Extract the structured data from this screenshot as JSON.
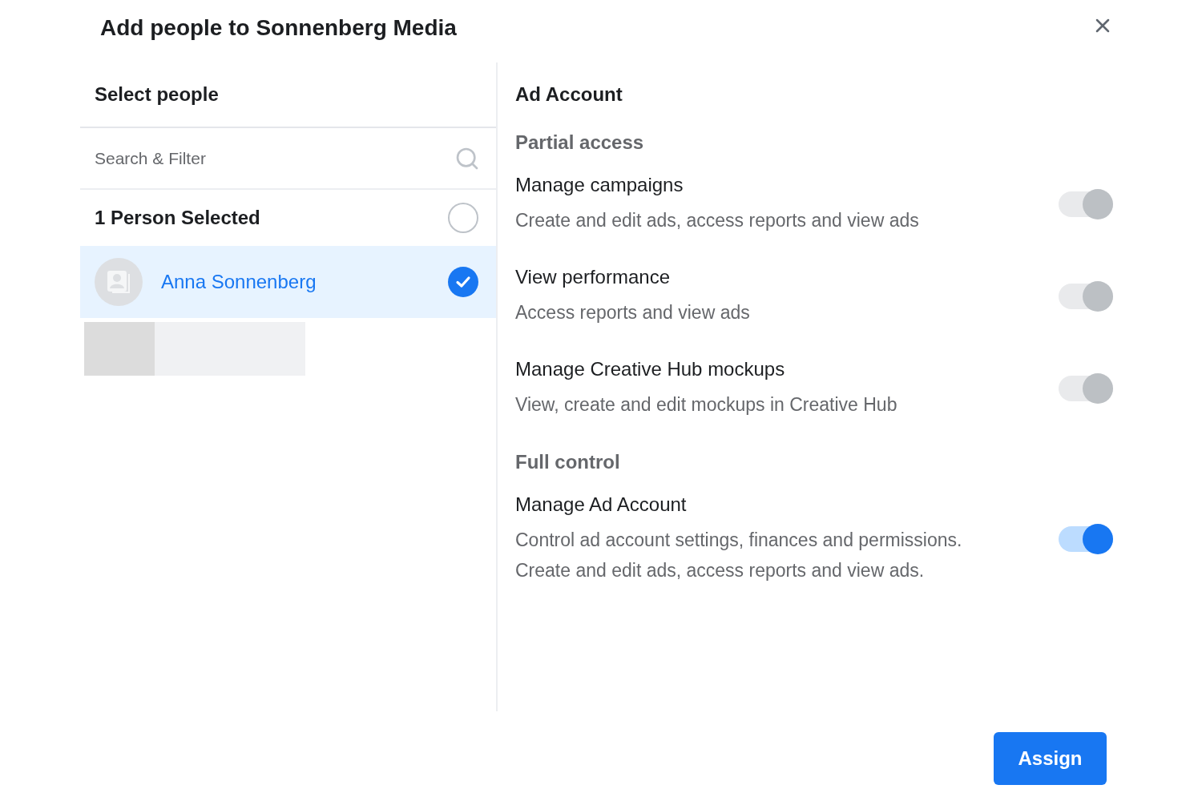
{
  "dialog": {
    "title": "Add people to Sonnenberg Media"
  },
  "people_panel": {
    "heading": "Select people",
    "search": {
      "placeholder": "Search & Filter"
    },
    "summary": {
      "label": "1 Person Selected",
      "checked": false
    },
    "people": [
      {
        "name": "Anna Sonnenberg",
        "selected": true
      }
    ]
  },
  "permissions_panel": {
    "heading": "Ad Account",
    "groups": [
      {
        "title": "Partial access",
        "permissions": [
          {
            "title": "Manage campaigns",
            "description": "Create and edit ads, access reports and view ads",
            "on": true,
            "disabled": true
          },
          {
            "title": "View performance",
            "description": "Access reports and view ads",
            "on": true,
            "disabled": true
          },
          {
            "title": "Manage Creative Hub mockups",
            "description": "View, create and edit mockups in Creative Hub",
            "on": true,
            "disabled": true
          }
        ]
      },
      {
        "title": "Full control",
        "permissions": [
          {
            "title": "Manage Ad Account",
            "description": "Control ad account settings, finances and permissions. Create and edit ads, access reports and view ads.",
            "on": true,
            "disabled": false
          }
        ]
      }
    ]
  },
  "footer": {
    "buttons": [
      "Assign"
    ]
  }
}
